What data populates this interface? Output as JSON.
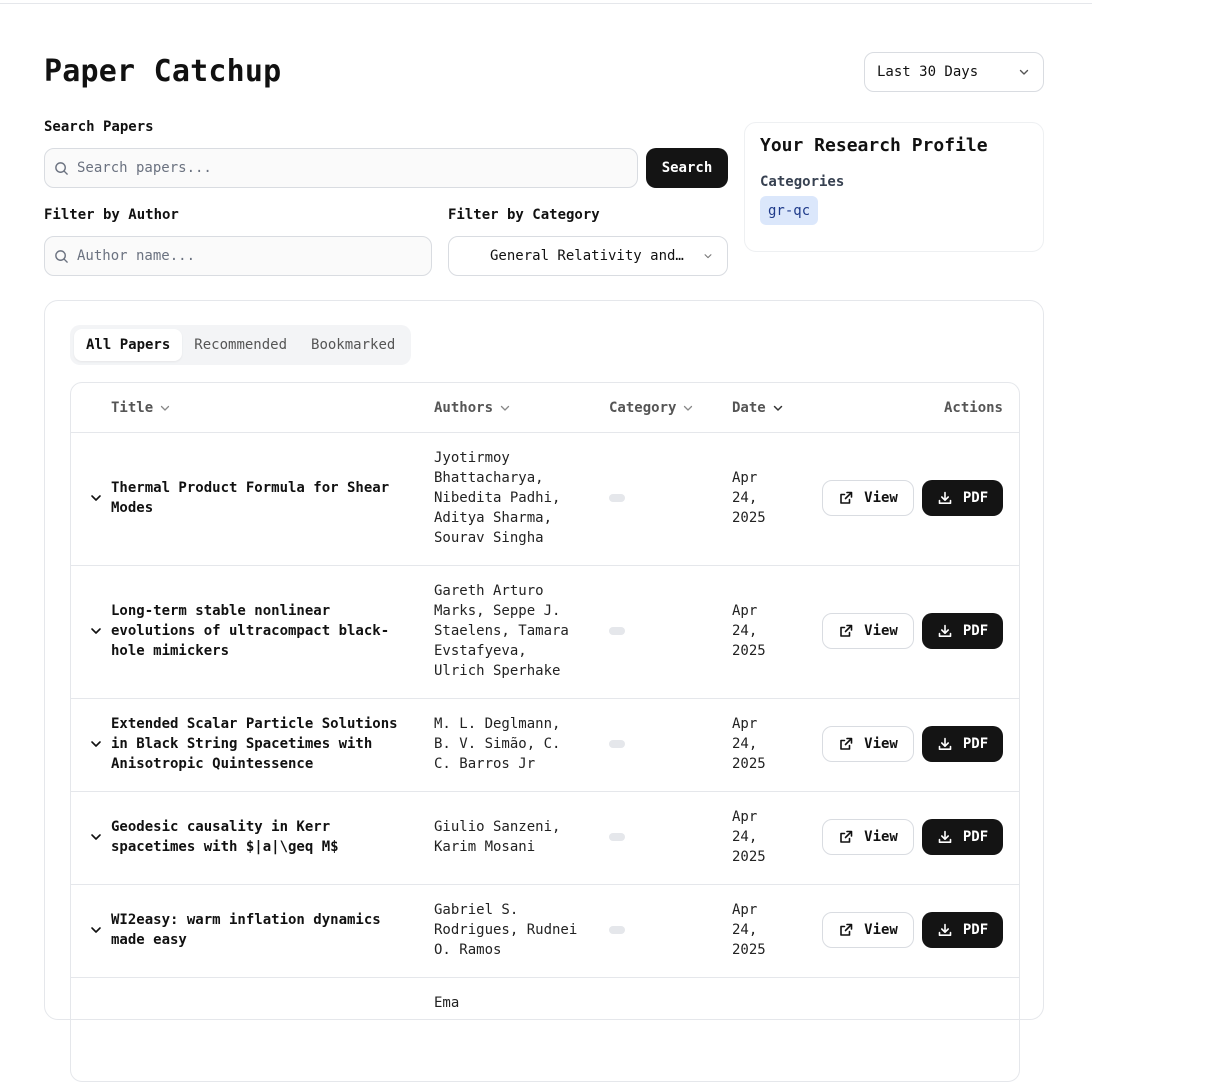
{
  "header": {
    "title": "Paper Catchup",
    "date_range": "Last 30 Days"
  },
  "search": {
    "label": "Search Papers",
    "placeholder": "Search papers...",
    "button": "Search"
  },
  "filters": {
    "author_label": "Filter by Author",
    "author_placeholder": "Author name...",
    "category_label": "Filter by Category",
    "category_value": "General Relativity and…"
  },
  "profile": {
    "title": "Your Research Profile",
    "categories_label": "Categories",
    "categories": [
      "gr-qc"
    ]
  },
  "tabs": [
    "All Papers",
    "Recommended",
    "Bookmarked"
  ],
  "table": {
    "columns": {
      "title": "Title",
      "authors": "Authors",
      "category": "Category",
      "date": "Date",
      "actions": "Actions"
    },
    "view_label": "View",
    "pdf_label": "PDF",
    "rows": [
      {
        "title": "Thermal Product Formula for Shear Modes",
        "authors": "Jyotirmoy Bhattacharya, Nibedita Padhi, Aditya Sharma, Sourav Singha",
        "date": "Apr 24, 2025"
      },
      {
        "title": "Long-term stable nonlinear evolutions of ultracompact black-hole mimickers",
        "authors": "Gareth Arturo Marks, Seppe J. Staelens, Tamara Evstafyeva, Ulrich Sperhake",
        "date": "Apr 24, 2025"
      },
      {
        "title": "Extended Scalar Particle Solutions in Black String Spacetimes with Anisotropic Quintessence",
        "authors": "M. L. Deglmann, B. V. Simão, C. C. Barros Jr",
        "date": "Apr 24, 2025"
      },
      {
        "title": "Geodesic causality in Kerr spacetimes with $|a|\\geq M$",
        "authors": "Giulio Sanzeni, Karim Mosani",
        "date": "Apr 24, 2025"
      },
      {
        "title": "WI2easy: warm inflation dynamics made easy",
        "authors": "Gabriel S. Rodrigues, Rudnei O. Ramos",
        "date": "Apr 24, 2025"
      },
      {
        "title": "",
        "authors": "Ema",
        "date": ""
      }
    ]
  }
}
